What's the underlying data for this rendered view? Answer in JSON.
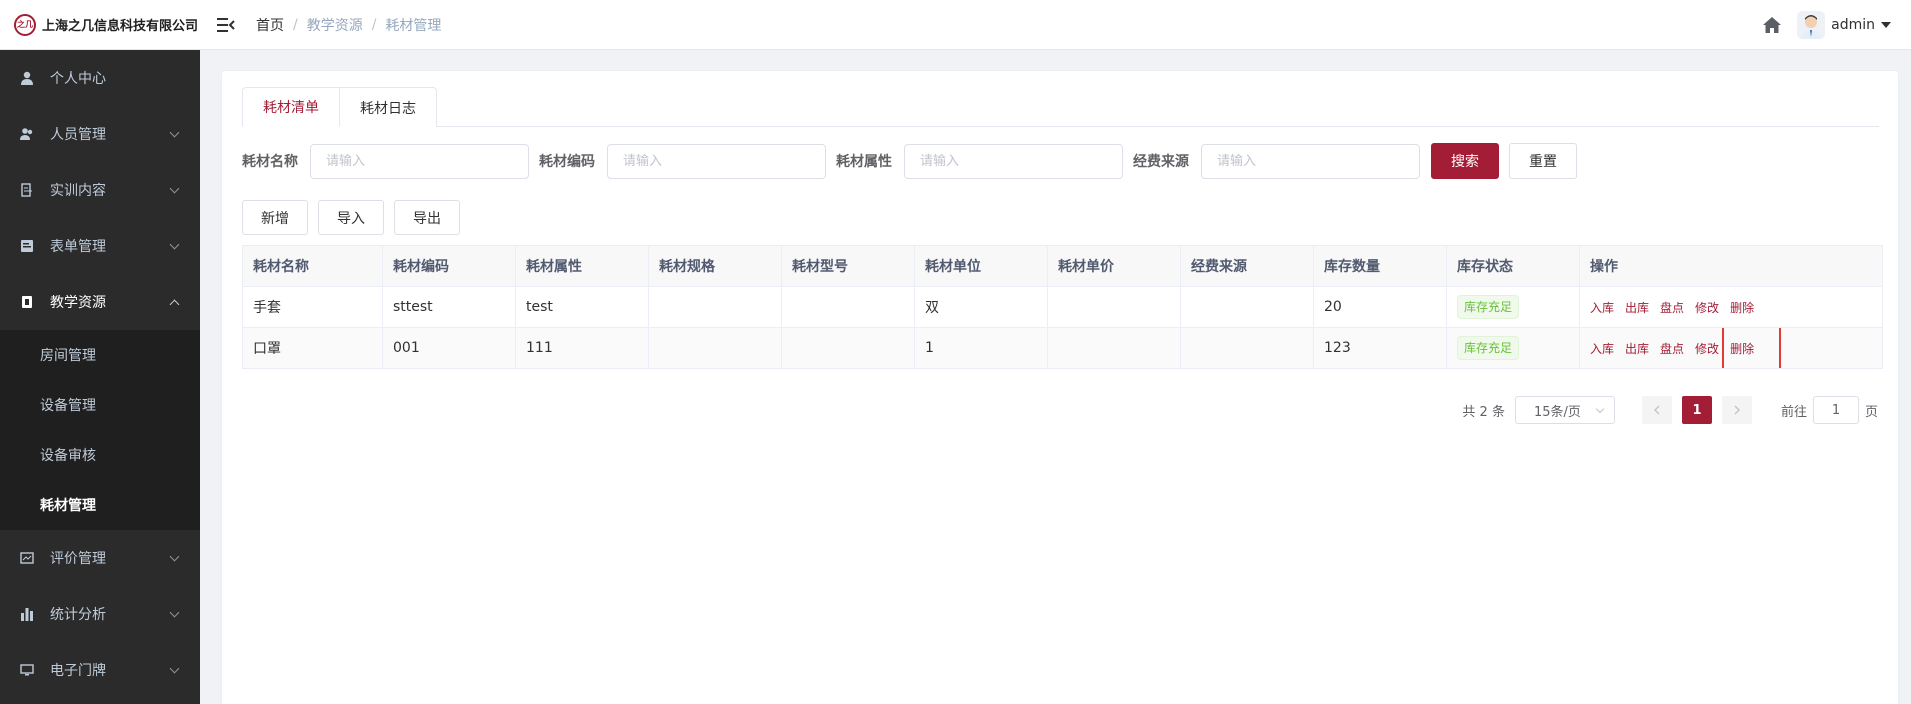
{
  "header": {
    "logo_mark": "之几",
    "company_name": "上海之几信息科技有限公司",
    "breadcrumb": [
      "首页",
      "教学资源",
      "耗材管理"
    ],
    "username": "admin"
  },
  "sidebar": {
    "items": [
      {
        "label": "个人中心",
        "icon": "user-icon"
      },
      {
        "label": "人员管理",
        "icon": "people-icon"
      },
      {
        "label": "实训内容",
        "icon": "book-icon"
      },
      {
        "label": "表单管理",
        "icon": "form-icon"
      },
      {
        "label": "教学资源",
        "icon": "resource-icon"
      },
      {
        "label": "评价管理",
        "icon": "evaluation-icon"
      },
      {
        "label": "统计分析",
        "icon": "chart-icon"
      },
      {
        "label": "电子门牌",
        "icon": "monitor-icon"
      }
    ],
    "sub_items": [
      "房间管理",
      "设备管理",
      "设备审核",
      "耗材管理"
    ]
  },
  "tabs": [
    "耗材清单",
    "耗材日志"
  ],
  "filters": {
    "labels": [
      "耗材名称",
      "耗材编码",
      "耗材属性",
      "经费来源"
    ],
    "placeholder": "请输入",
    "search_label": "搜索",
    "reset_label": "重置"
  },
  "actions": [
    "新增",
    "导入",
    "导出"
  ],
  "table": {
    "columns": [
      "耗材名称",
      "耗材编码",
      "耗材属性",
      "耗材规格",
      "耗材型号",
      "耗材单位",
      "耗材单价",
      "经费来源",
      "库存数量",
      "库存状态",
      "操作"
    ],
    "rows": [
      [
        "手套",
        "sttest",
        "test",
        "",
        "",
        "双",
        "",
        "",
        "20",
        "库存充足"
      ],
      [
        "口罩",
        "001",
        "111",
        "",
        "",
        "1",
        "",
        "",
        "123",
        "库存充足"
      ]
    ],
    "ops": [
      "入库",
      "出库",
      "盘点",
      "修改",
      "删除"
    ]
  },
  "pagination": {
    "total": "共 2 条",
    "page_size": "15条/页",
    "current_page": "1",
    "goto_prefix": "前往",
    "goto_value": "1",
    "goto_suffix": "页"
  },
  "colors": {
    "primary": "#a31d36",
    "sidebar_bg": "#2b2b2b",
    "submenu_bg": "#1f1f1f",
    "highlight": "#e53935"
  }
}
